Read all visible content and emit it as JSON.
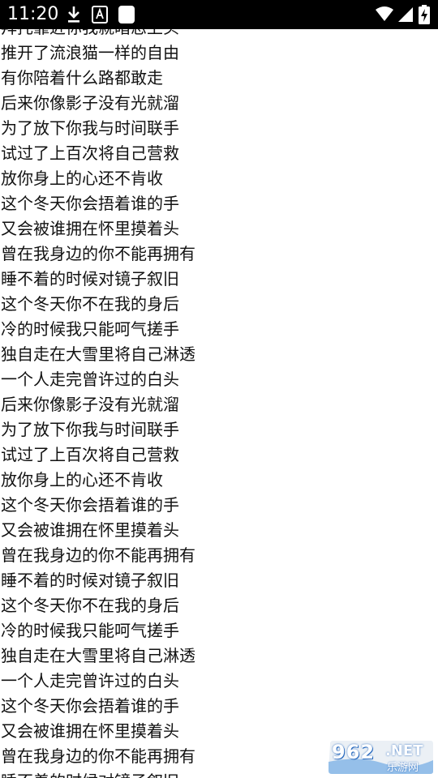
{
  "status_bar": {
    "time": "11:20",
    "icons": [
      "download-icon",
      "text-a-icon",
      "blank-app-icon",
      "wifi-icon",
      "signal-icon",
      "battery-charging-icon"
    ]
  },
  "lyrics": [
    "拜托靠近你我就暗恋上头",
    "推开了流浪猫一样的自由",
    "有你陪着什么路都敢走",
    "后来你像影子没有光就溜",
    "为了放下你我与时间联手",
    "试过了上百次将自己营救",
    "放你身上的心还不肯收",
    "这个冬天你会捂着谁的手",
    "又会被谁拥在怀里摸着头",
    "曾在我身边的你不能再拥有",
    "睡不着的时候对镜子叙旧",
    "这个冬天你不在我的身后",
    "冷的时候我只能呵气搓手",
    "独自走在大雪里将自己淋透",
    "一个人走完曾许过的白头",
    "后来你像影子没有光就溜",
    "为了放下你我与时间联手",
    "试过了上百次将自己营救",
    "放你身上的心还不肯收",
    "这个冬天你会捂着谁的手",
    "又会被谁拥在怀里摸着头",
    "曾在我身边的你不能再拥有",
    "睡不着的时候对镜子叙旧",
    "这个冬天你不在我的身后",
    "冷的时候我只能呵气搓手",
    "独自走在大雪里将自己淋透",
    "一个人走完曾许过的白头",
    "这个冬天你会捂着谁的手",
    "又会被谁拥在怀里摸着头",
    "曾在我身边的你不能再拥有",
    "睡不着的时候对镜子叙旧"
  ],
  "watermark": {
    "number": "962",
    "suffix": ".NET",
    "name": "乐游网"
  }
}
